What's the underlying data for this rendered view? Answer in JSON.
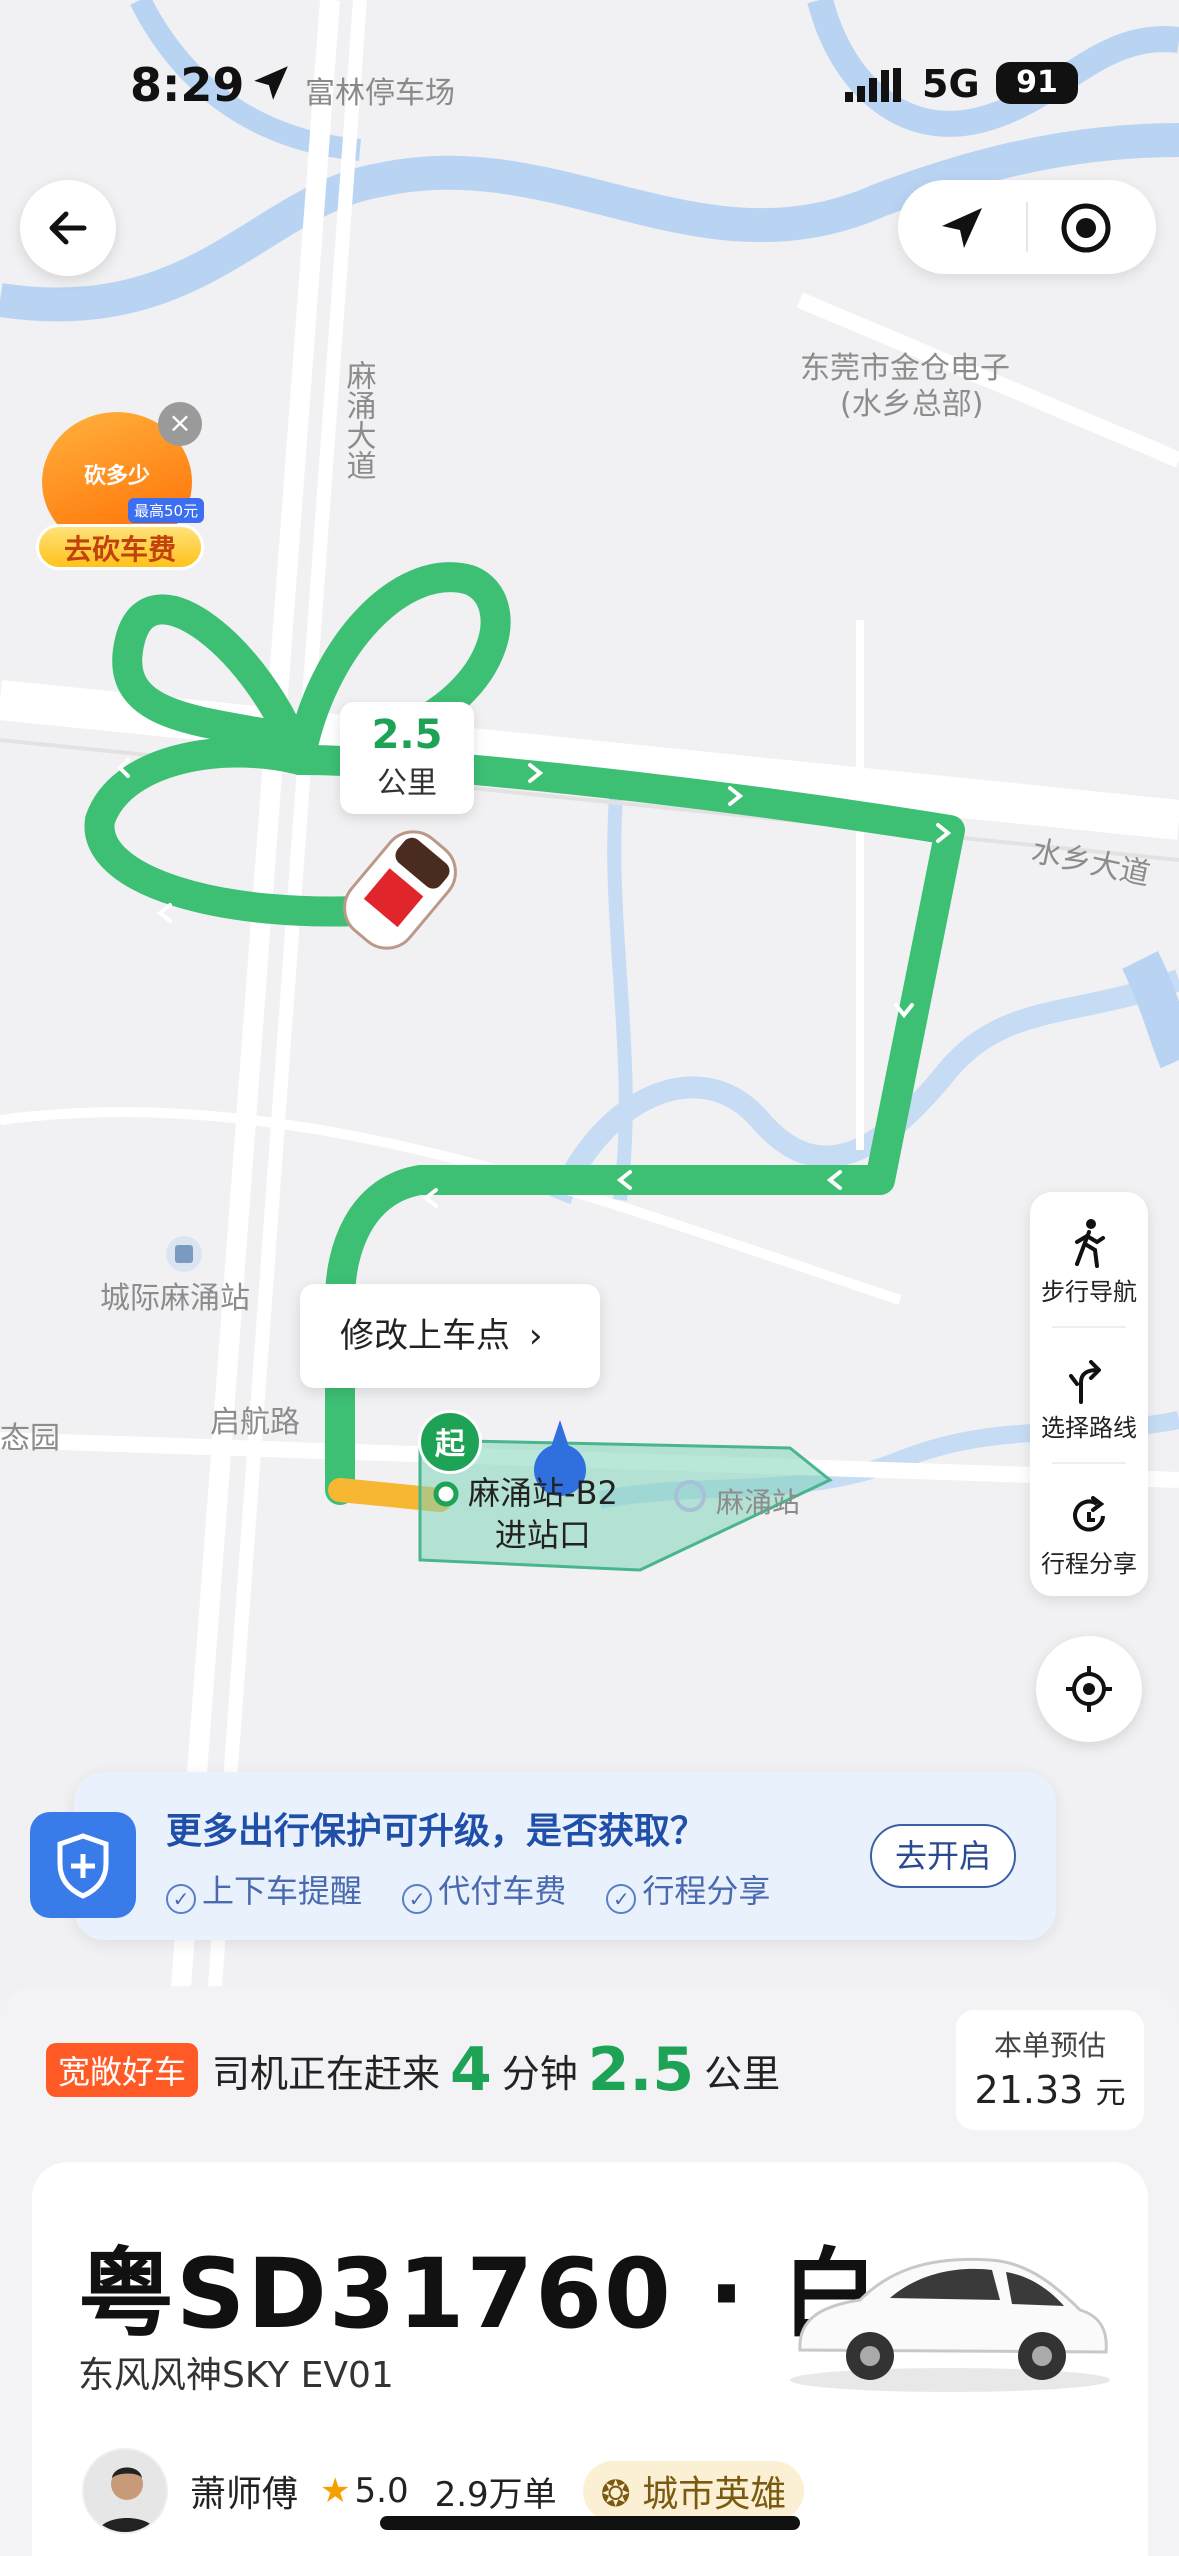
{
  "status_bar": {
    "time": "8:29",
    "place": "富林停车场",
    "network": "5G",
    "battery": "91"
  },
  "map": {
    "labels": {
      "road_madao": "麻涌大道",
      "company": "东莞市金仓电子",
      "company_sub": "(水乡总部)",
      "shuixiang": "水乡大道",
      "bus_station": "城际麻涌站",
      "qihang": "启航路",
      "park_edge": "态园",
      "station_map": "麻涌站"
    },
    "route_color": "#3dbf74"
  },
  "promo": {
    "top_text": "砍多少",
    "small_text": "最高50元",
    "bottom_text": "去砍车费"
  },
  "distance_bubble": {
    "value": "2.5",
    "unit": "公里"
  },
  "edit_pickup": {
    "label": "修改上车点",
    "chevron": "›"
  },
  "pickup": {
    "badge": "起",
    "station_line1": "麻涌站-B2",
    "station_line2": "进站口"
  },
  "side_panel": {
    "items": [
      {
        "label": "步行导航",
        "icon": "walk-icon"
      },
      {
        "label": "选择路线",
        "icon": "route-icon"
      },
      {
        "label": "行程分享",
        "icon": "share-icon"
      }
    ]
  },
  "protection": {
    "title": "更多出行保护可升级，是否获取？",
    "items": [
      "上下车提醒",
      "代付车费",
      "行程分享"
    ],
    "button": "去开启"
  },
  "eta": {
    "tag": "宽敞好车",
    "text": "司机正在赶来",
    "minutes": "4",
    "minutes_unit": "分钟",
    "distance": "2.5",
    "distance_unit": "公里"
  },
  "fare": {
    "label": "本单预估",
    "amount": "21.33",
    "unit": "元"
  },
  "vehicle": {
    "plate": "粤SD31760 · 白",
    "model": "东风风神SKY EV01"
  },
  "driver": {
    "name": "萧师傅",
    "rating": "5.0",
    "orders": "2.9万单",
    "badge": "城市英雄"
  }
}
